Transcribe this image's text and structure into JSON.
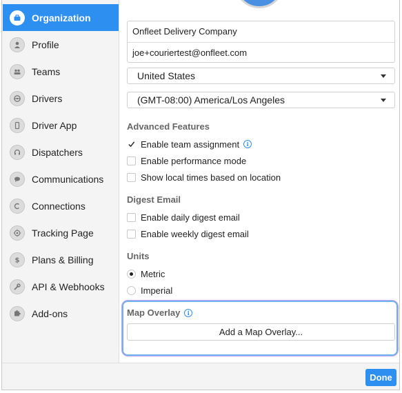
{
  "sidebar": {
    "items": [
      {
        "label": "Organization",
        "icon": "briefcase-icon",
        "active": true
      },
      {
        "label": "Profile",
        "icon": "person-icon"
      },
      {
        "label": "Teams",
        "icon": "group-icon"
      },
      {
        "label": "Drivers",
        "icon": "steering-wheel-icon"
      },
      {
        "label": "Driver App",
        "icon": "phone-icon"
      },
      {
        "label": "Dispatchers",
        "icon": "headset-icon"
      },
      {
        "label": "Communications",
        "icon": "chat-bubble-icon"
      },
      {
        "label": "Connections",
        "icon": "plug-icon"
      },
      {
        "label": "Tracking Page",
        "icon": "target-icon"
      },
      {
        "label": "Plans & Billing",
        "icon": "dollar-icon"
      },
      {
        "label": "API & Webhooks",
        "icon": "wrench-icon"
      },
      {
        "label": "Add-ons",
        "icon": "puzzle-icon"
      }
    ]
  },
  "organization": {
    "name": "Onfleet Delivery Company",
    "email": "joe+couriertest@onfleet.com",
    "country": "United States",
    "timezone": "(GMT-08:00) America/Los Angeles"
  },
  "advanced": {
    "title": "Advanced Features",
    "options": [
      {
        "label": "Enable team assignment",
        "checked": true,
        "info": true
      },
      {
        "label": "Enable performance mode",
        "checked": false
      },
      {
        "label": "Show local times based on location",
        "checked": false
      }
    ]
  },
  "digest": {
    "title": "Digest Email",
    "options": [
      {
        "label": "Enable daily digest email",
        "checked": false
      },
      {
        "label": "Enable weekly digest email",
        "checked": false
      }
    ]
  },
  "units": {
    "title": "Units",
    "options": [
      {
        "label": "Metric",
        "selected": true
      },
      {
        "label": "Imperial",
        "selected": false
      }
    ]
  },
  "map_overlay": {
    "title": "Map Overlay",
    "button": "Add a Map Overlay..."
  },
  "footer": {
    "done": "Done"
  },
  "colors": {
    "accent": "#2d8ff0",
    "sidebar_bg": "#f4f4f4"
  }
}
